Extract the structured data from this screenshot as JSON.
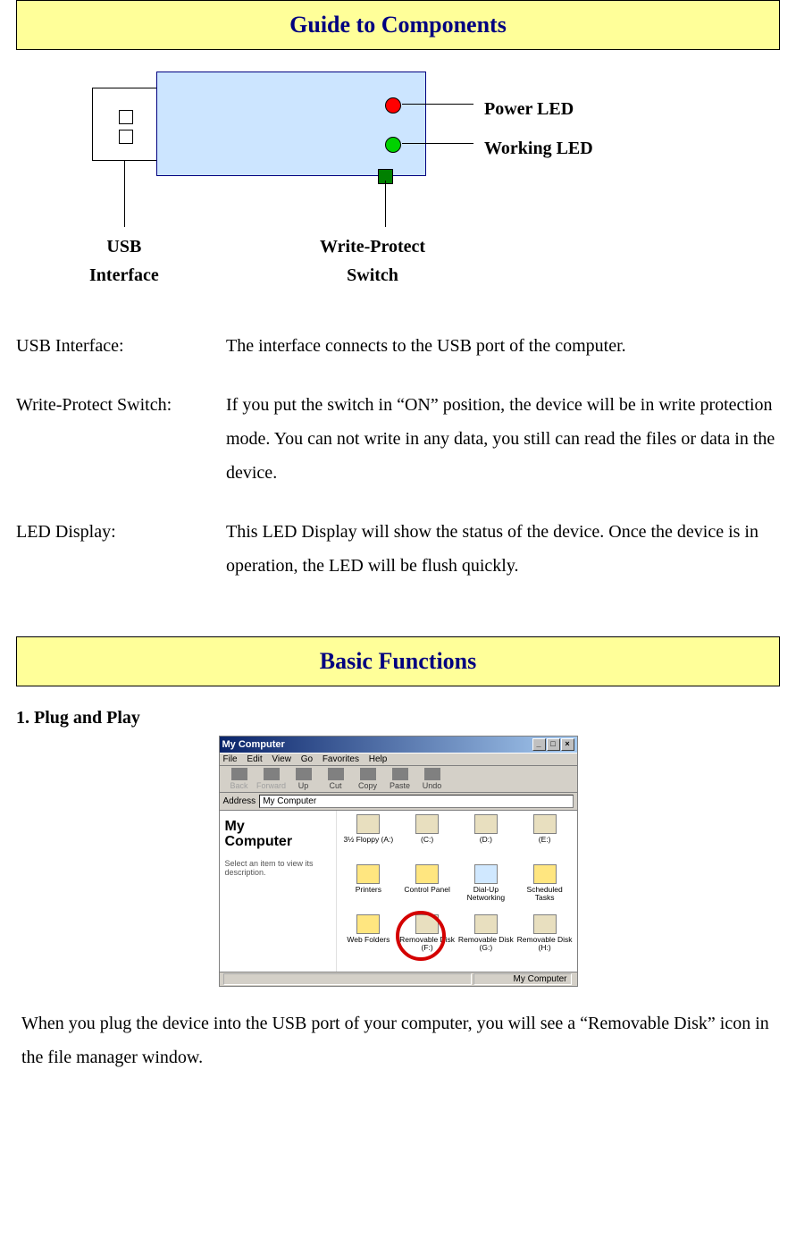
{
  "banner1": "Guide to Components",
  "diagram": {
    "power_led": "Power LED",
    "working_led": "Working LED",
    "usb_interface": "USB\nInterface",
    "write_protect": "Write-Protect\nSwitch"
  },
  "defs": [
    {
      "term": "USB Interface:",
      "desc": "The interface connects to the USB port of the computer."
    },
    {
      "term": "Write-Protect Switch:",
      "desc": "If you put the switch in “ON” position, the device will be in write protection mode. You can not write in any data, you still can read the files or data in the device."
    },
    {
      "term": "LED Display:",
      "desc": "This LED Display will show the status of the device. Once the device is in operation, the LED will be flush quickly."
    }
  ],
  "banner2": "Basic Functions",
  "section1": "1.   Plug and Play",
  "mc": {
    "title": "My Computer",
    "menus": [
      "File",
      "Edit",
      "View",
      "Go",
      "Favorites",
      "Help"
    ],
    "toolbar": [
      "Back",
      "Forward",
      "Up",
      "Cut",
      "Copy",
      "Paste",
      "Undo"
    ],
    "addr_label": "Address",
    "addr_value": "My Computer",
    "side_title": "My\nComputer",
    "side_tip": "Select an item to view its description.",
    "items": [
      {
        "label": "3½ Floppy (A:)",
        "cls": "drv"
      },
      {
        "label": "(C:)",
        "cls": "drv"
      },
      {
        "label": "(D:)",
        "cls": "drv"
      },
      {
        "label": "(E:)",
        "cls": "drv"
      },
      {
        "label": "Printers",
        "cls": "fld"
      },
      {
        "label": "Control Panel",
        "cls": "fld"
      },
      {
        "label": "Dial-Up Networking",
        "cls": "net"
      },
      {
        "label": "Scheduled Tasks",
        "cls": "fld"
      },
      {
        "label": "Web Folders",
        "cls": "fld"
      },
      {
        "label": "Removable Disk (F:)",
        "cls": "drv"
      },
      {
        "label": "Removable Disk (G:)",
        "cls": "drv"
      },
      {
        "label": "Removable Disk (H:)",
        "cls": "drv"
      }
    ],
    "status_right": "My Computer"
  },
  "bottom": "When you plug the device into the USB port of your computer, you will see a “Removable Disk” icon in the file manager window."
}
